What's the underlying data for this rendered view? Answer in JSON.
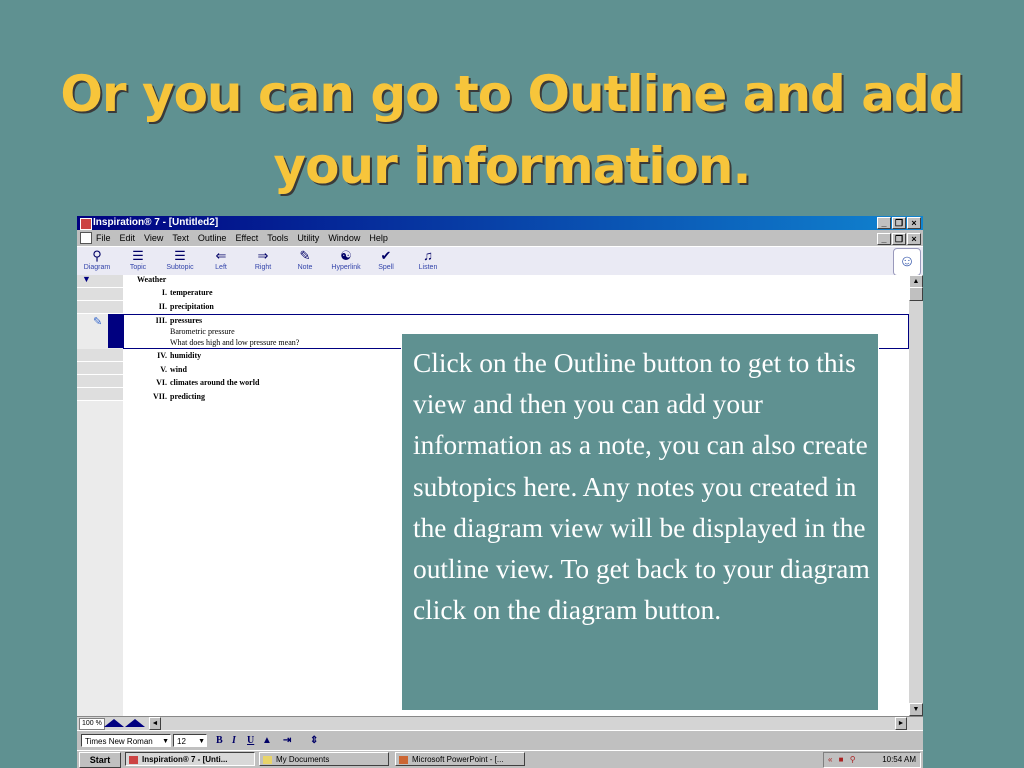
{
  "slide": {
    "title_line1": "Or you can go to Outline and add",
    "title_line2": "your information.",
    "callout": "Click on the Outline button to get to this view and then you can add your information as a note, you can also create subtopics here.  Any notes you created in the diagram view will be displayed in the outline view. To get back to your diagram click on the diagram button."
  },
  "app": {
    "window_title": "Inspiration® 7 - [Untitled2]",
    "menu": [
      "File",
      "Edit",
      "View",
      "Text",
      "Outline",
      "Effect",
      "Tools",
      "Utility",
      "Window",
      "Help"
    ],
    "toolbar": [
      {
        "label": "Diagram",
        "icon": "diagram-icon"
      },
      {
        "label": "Topic",
        "icon": "topic-icon"
      },
      {
        "label": "Subtopic",
        "icon": "subtopic-icon"
      },
      {
        "label": "Left",
        "icon": "left-icon"
      },
      {
        "label": "Right",
        "icon": "right-icon"
      },
      {
        "label": "Note",
        "icon": "note-icon"
      },
      {
        "label": "Hyperlink",
        "icon": "hyperlink-icon"
      },
      {
        "label": "Spell",
        "icon": "spell-icon"
      },
      {
        "label": "Listen",
        "icon": "listen-icon"
      }
    ],
    "outline": {
      "root": "Weather",
      "items": [
        {
          "num": "I.",
          "text": "temperature"
        },
        {
          "num": "II.",
          "text": "precipitation"
        },
        {
          "num": "III.",
          "text": "pressures",
          "notes": [
            "Barometric pressure",
            "What does high and low pressure mean?"
          ]
        },
        {
          "num": "IV.",
          "text": "humidity"
        },
        {
          "num": "V.",
          "text": "wind"
        },
        {
          "num": "VI.",
          "text": "climates around the world"
        },
        {
          "num": "VII.",
          "text": "predicting"
        }
      ]
    },
    "zoom": "100 %",
    "format": {
      "font": "Times New Roman",
      "size": "12",
      "bold": "B",
      "italic": "I",
      "underline": "U"
    },
    "taskbar": {
      "start": "Start",
      "tasks": [
        "Inspiration® 7 - [Unti...",
        "My Documents",
        "Microsoft PowerPoint - [..."
      ],
      "clock": "10:54 AM",
      "tray_chevron": "«"
    }
  }
}
